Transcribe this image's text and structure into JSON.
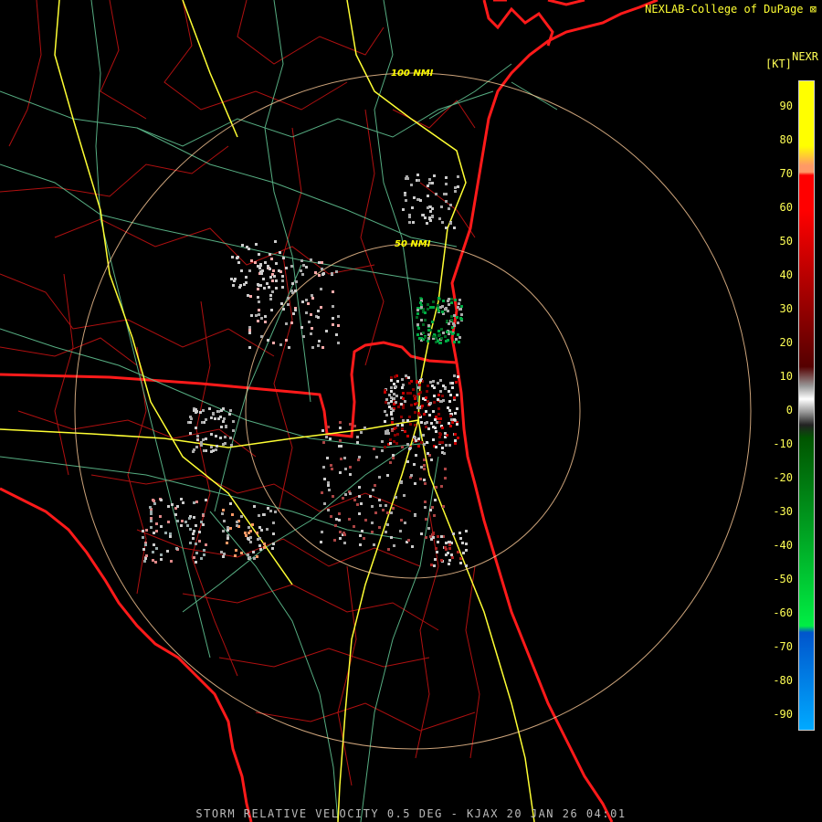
{
  "header": {
    "credit": "NEXLAB-College of DuPage",
    "product_code": "NEXR",
    "units": "[KT]"
  },
  "footer": {
    "caption": "STORM RELATIVE VELOCITY 0.5 DEG - KJAX 20 JAN 26 04:01"
  },
  "range_rings": [
    {
      "label": "50 NMI"
    },
    {
      "label": "100 NMI"
    }
  ],
  "legend": {
    "ticks": [
      "90",
      "80",
      "70",
      "60",
      "50",
      "40",
      "30",
      "20",
      "10",
      "0",
      "-10",
      "-20",
      "-30",
      "-40",
      "-50",
      "-60",
      "-70",
      "-80",
      "-90"
    ],
    "colors": {
      "high": "#ffff00",
      "orange": "#ff9966",
      "red": "#ff0000",
      "dark_red": "#550000",
      "gray": "#999999",
      "dark_green": "#005500",
      "green": "#00ee44",
      "blue": "#0055cc",
      "light_blue": "#00aaff"
    }
  },
  "map_colors": {
    "state_border": "#ff1a1a",
    "county_border": "#c01010",
    "highway": "#ffff33",
    "road": "#66cc99",
    "range_ring": "#ffcc99"
  }
}
